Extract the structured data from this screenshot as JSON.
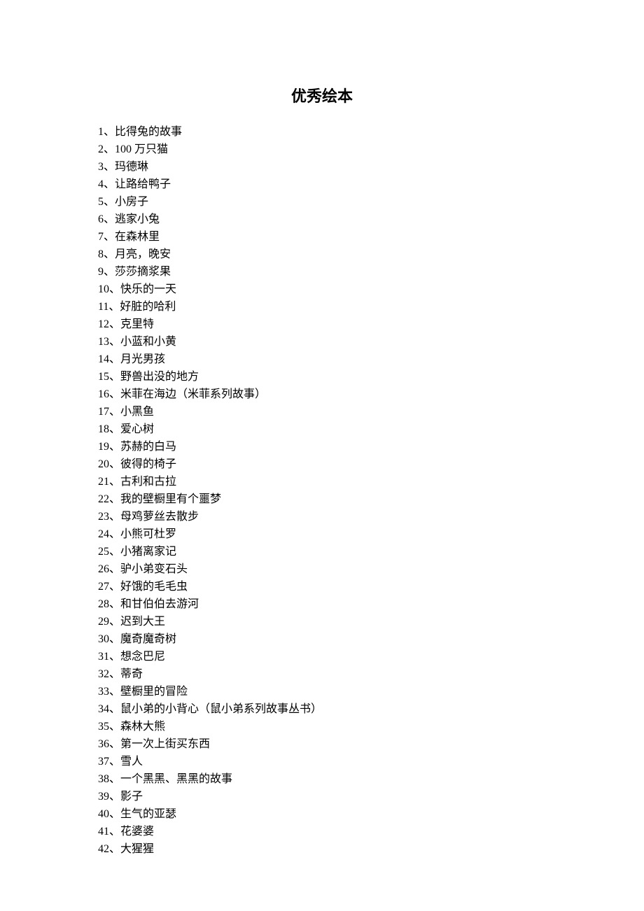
{
  "title": "优秀绘本",
  "separator": "、",
  "items": [
    {
      "n": "1",
      "t": "比得兔的故事"
    },
    {
      "n": "2",
      "t": "100 万只猫"
    },
    {
      "n": "3",
      "t": "玛德琳"
    },
    {
      "n": "4",
      "t": "让路给鸭子"
    },
    {
      "n": "5",
      "t": "小房子"
    },
    {
      "n": "6",
      "t": "逃家小兔"
    },
    {
      "n": "7",
      "t": "在森林里"
    },
    {
      "n": "8",
      "t": "月亮，晚安"
    },
    {
      "n": "9",
      "t": "莎莎摘浆果"
    },
    {
      "n": "10",
      "t": "快乐的一天"
    },
    {
      "n": "11",
      "t": "好脏的哈利"
    },
    {
      "n": "12",
      "t": "克里特"
    },
    {
      "n": "13",
      "t": "小蓝和小黄"
    },
    {
      "n": "14",
      "t": "月光男孩"
    },
    {
      "n": "15",
      "t": "野兽出没的地方"
    },
    {
      "n": "16",
      "t": "米菲在海边（米菲系列故事）"
    },
    {
      "n": "17",
      "t": "小黑鱼"
    },
    {
      "n": "18",
      "t": "爱心树"
    },
    {
      "n": "19",
      "t": "苏赫的白马"
    },
    {
      "n": "20",
      "t": "彼得的椅子"
    },
    {
      "n": "21",
      "t": "古利和古拉"
    },
    {
      "n": "22",
      "t": "我的壁橱里有个噩梦"
    },
    {
      "n": "23",
      "t": "母鸡萝丝去散步"
    },
    {
      "n": "24",
      "t": "小熊可杜罗"
    },
    {
      "n": "25",
      "t": "小猪离家记"
    },
    {
      "n": "26",
      "t": "驴小弟变石头"
    },
    {
      "n": "27",
      "t": "好饿的毛毛虫"
    },
    {
      "n": "28",
      "t": "和甘伯伯去游河"
    },
    {
      "n": "29",
      "t": "迟到大王"
    },
    {
      "n": "30",
      "t": "魔奇魔奇树"
    },
    {
      "n": "31",
      "t": "想念巴尼"
    },
    {
      "n": "32",
      "t": "蒂奇"
    },
    {
      "n": "33",
      "t": "壁橱里的冒险"
    },
    {
      "n": "34",
      "t": "鼠小弟的小背心（鼠小弟系列故事丛书）"
    },
    {
      "n": "35",
      "t": "森林大熊"
    },
    {
      "n": "36",
      "t": "第一次上街买东西"
    },
    {
      "n": "37",
      "t": "雪人"
    },
    {
      "n": "38",
      "t": "一个黑黑、黑黑的故事"
    },
    {
      "n": "39",
      "t": "影子"
    },
    {
      "n": "40",
      "t": "生气的亚瑟"
    },
    {
      "n": "41",
      "t": "花婆婆"
    },
    {
      "n": "42",
      "t": "大猩猩"
    }
  ]
}
